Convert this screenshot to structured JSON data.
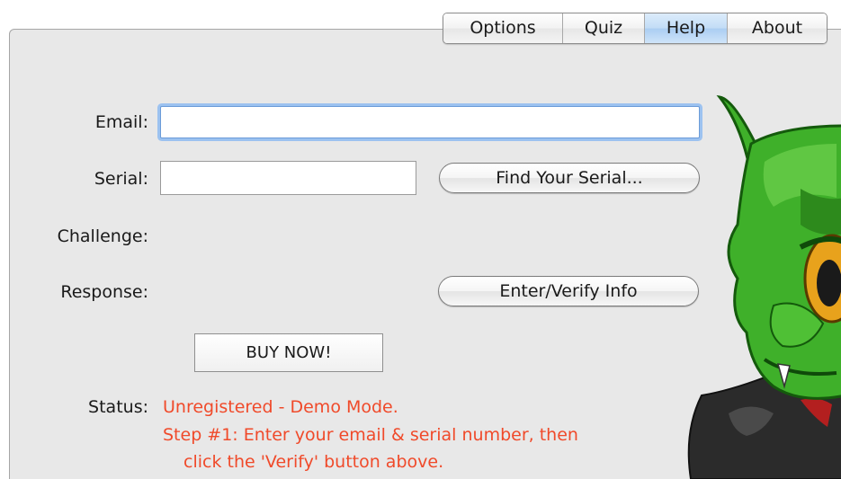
{
  "tabs": [
    {
      "label": "Options",
      "active": false
    },
    {
      "label": "Quiz",
      "active": false
    },
    {
      "label": "Help",
      "active": true
    },
    {
      "label": "About",
      "active": false
    }
  ],
  "form": {
    "email_label": "Email:",
    "email_value": "",
    "serial_label": "Serial:",
    "serial_value": "",
    "find_serial_button": "Find Your Serial...",
    "challenge_label": "Challenge:",
    "challenge_value": "",
    "response_label": "Response:",
    "response_value": "",
    "verify_button": "Enter/Verify Info",
    "buy_button": "BUY NOW!"
  },
  "status": {
    "label": "Status:",
    "line1": "Unregistered - Demo Mode.",
    "line2": "Step #1: Enter your email & serial number, then",
    "line3": "click the 'Verify' button above."
  },
  "colors": {
    "status_text": "#f04a2a",
    "focus_ring": "#9cc2f0",
    "active_tab": "#c2dcf6",
    "panel_bg": "#e8e8e8",
    "mascot_skin": "#3fb02a"
  },
  "icons": {
    "mascot": "green-goblin-mascot"
  }
}
